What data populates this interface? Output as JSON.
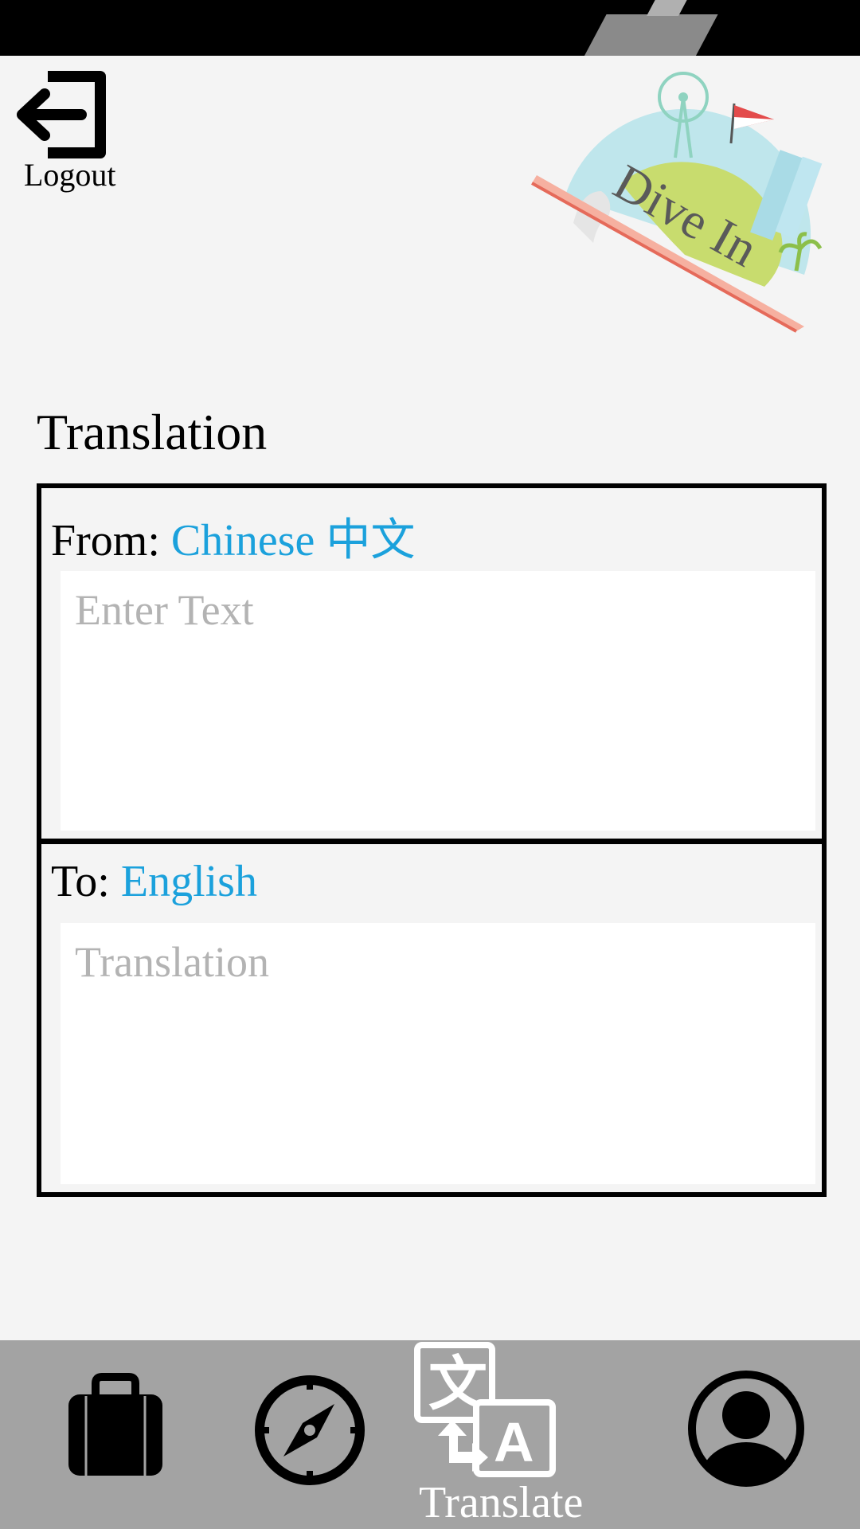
{
  "header": {
    "logout_label": "Logout",
    "logo_text": "Dive In"
  },
  "page": {
    "title": "Translation"
  },
  "translator": {
    "from_prefix": "From: ",
    "from_language": "Chinese 中文",
    "source_placeholder": "Enter Text",
    "to_prefix": "To: ",
    "to_language": "English",
    "target_placeholder": "Translation"
  },
  "nav": {
    "items": [
      {
        "icon": "briefcase-icon",
        "label": ""
      },
      {
        "icon": "compass-icon",
        "label": ""
      },
      {
        "icon": "translate-icon",
        "label": "Translate",
        "active": true
      },
      {
        "icon": "profile-icon",
        "label": ""
      }
    ]
  },
  "colors": {
    "accent": "#1ba1dc",
    "nav_bg": "#a3a3a3",
    "page_bg": "#f4f4f4"
  }
}
